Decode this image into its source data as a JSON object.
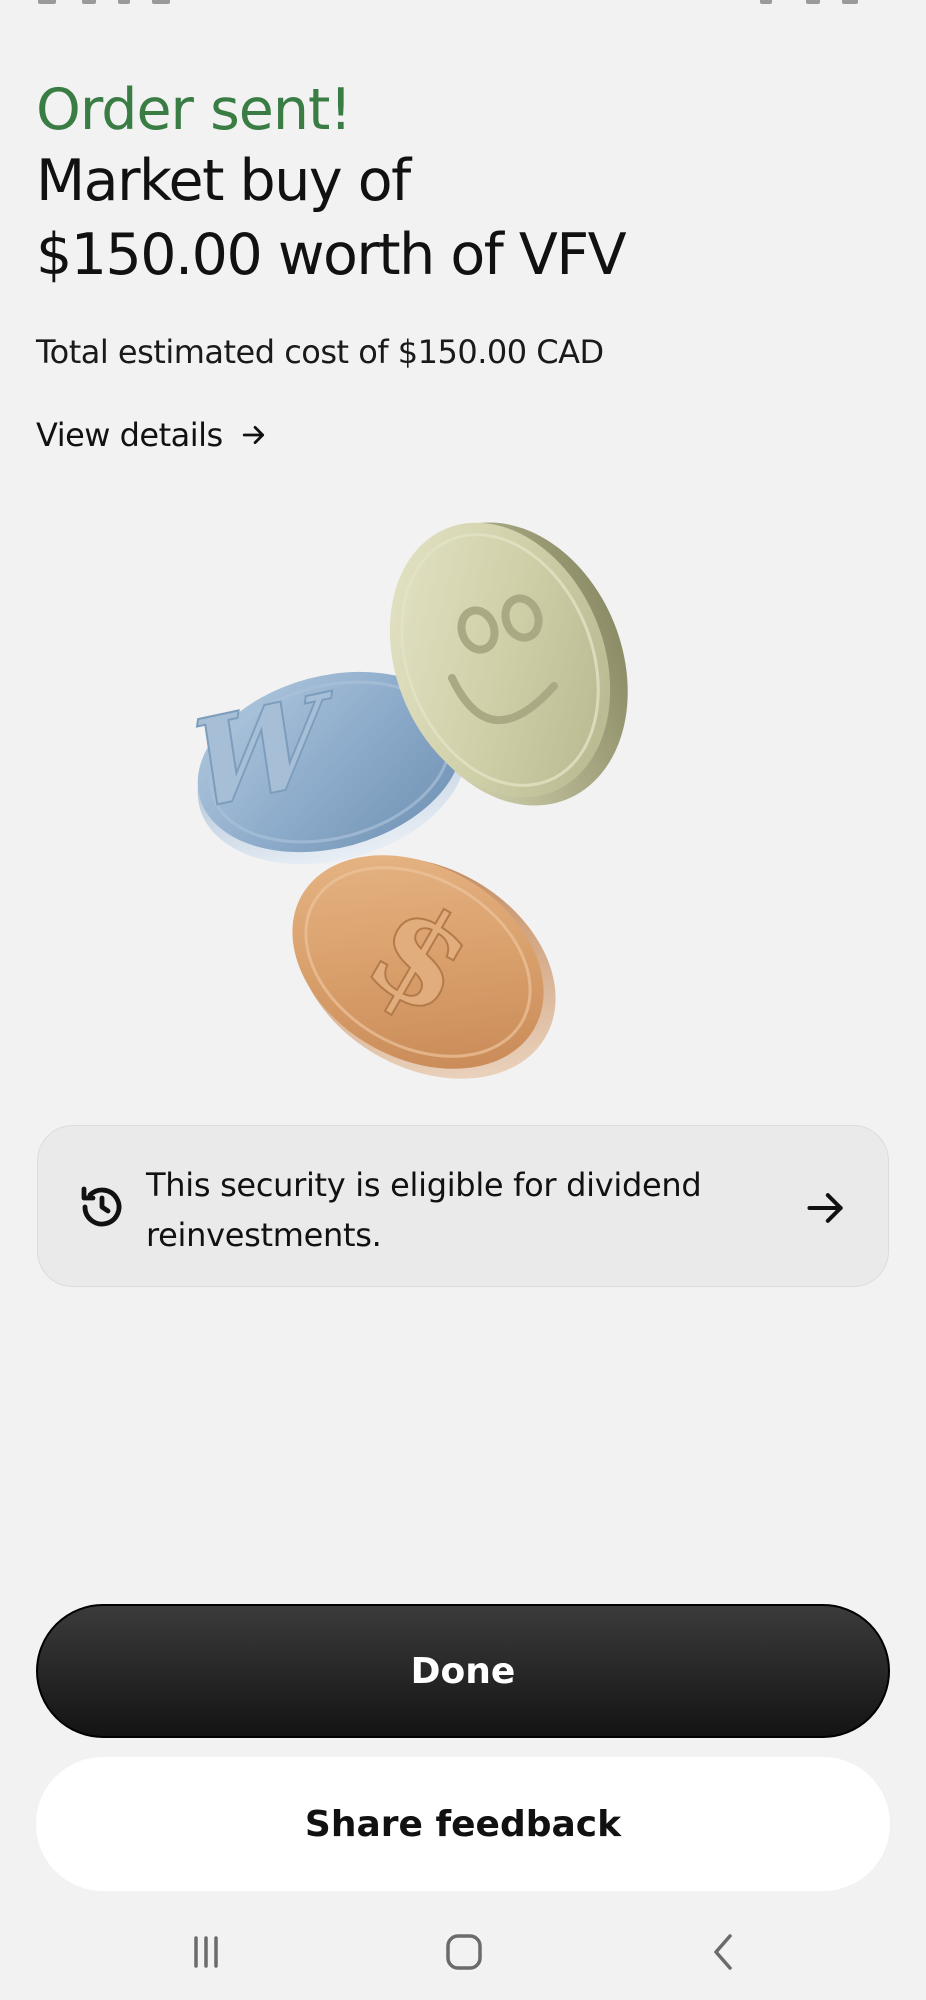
{
  "header": {
    "status": "Order sent!",
    "title_line1": "Market buy of",
    "title_line2": "$150.00 worth of VFV",
    "total_cost": "Total estimated cost of $150.00 CAD",
    "view_details": "View details"
  },
  "illustration": {
    "coin_w_letter": "W",
    "coin_dollar_symbol": "$"
  },
  "drip_card": {
    "text": "This security is eligible for dividend reinvestments."
  },
  "actions": {
    "done": "Done",
    "share_feedback": "Share feedback"
  },
  "colors": {
    "status_green": "#3a7d44",
    "background": "#f2f2f2",
    "done_button": "#1e1e1e"
  },
  "nav": {
    "recents_icon": "recents-icon",
    "home_icon": "home-icon",
    "back_icon": "back-icon"
  }
}
